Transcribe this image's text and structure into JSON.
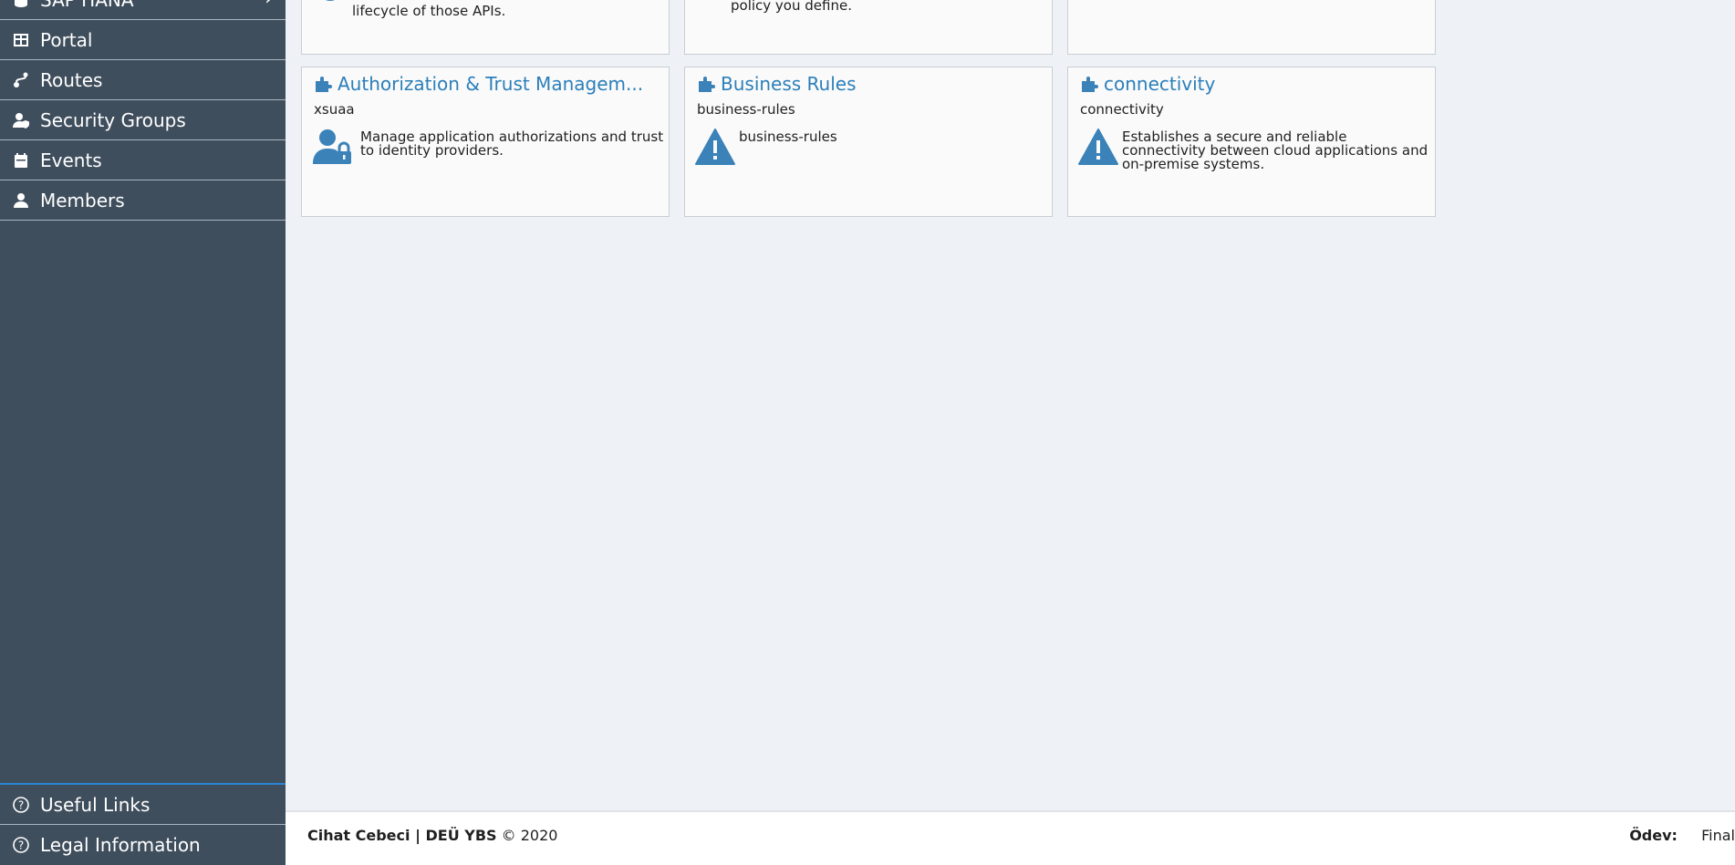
{
  "sidebar": {
    "top_partial_label": "SAP HANA",
    "items": [
      {
        "label": "Portal",
        "icon": "table-icon"
      },
      {
        "label": "Routes",
        "icon": "routes-icon"
      },
      {
        "label": "Security Groups",
        "icon": "security-groups-icon"
      },
      {
        "label": "Events",
        "icon": "calendar-icon"
      },
      {
        "label": "Members",
        "icon": "person-icon"
      }
    ],
    "bottom_items": [
      {
        "label": "Useful Links",
        "icon": "help-circle-icon"
      },
      {
        "label": "Legal Information",
        "icon": "help-circle-icon"
      }
    ]
  },
  "tiles_top_partial": [
    {
      "desc": "lifecycle of those APIs."
    },
    {
      "desc": "policy you define."
    },
    {
      "desc": ""
    }
  ],
  "tiles": [
    {
      "title": "Authorization & Trust Managem...",
      "subtitle": "xsuaa",
      "icon": "user-lock-icon",
      "desc": "Manage application authorizations and trust to identity providers."
    },
    {
      "title": "Business Rules",
      "subtitle": "business-rules",
      "icon": "warning-icon",
      "desc": "business-rules"
    },
    {
      "title": "connectivity",
      "subtitle": "connectivity",
      "icon": "warning-icon",
      "desc": "Establishes a secure and reliable connectivity between cloud applications and on-premise systems."
    }
  ],
  "footer": {
    "author": "Cihat Cebeci | DEÜ YBS",
    "copyright": "© 2020",
    "assignment_label": "Ödev:",
    "assignment_value": "Final"
  },
  "colors": {
    "sidebar_bg": "#3f4e5d",
    "accent": "#2b7fba",
    "content_bg": "#eef1f5"
  }
}
